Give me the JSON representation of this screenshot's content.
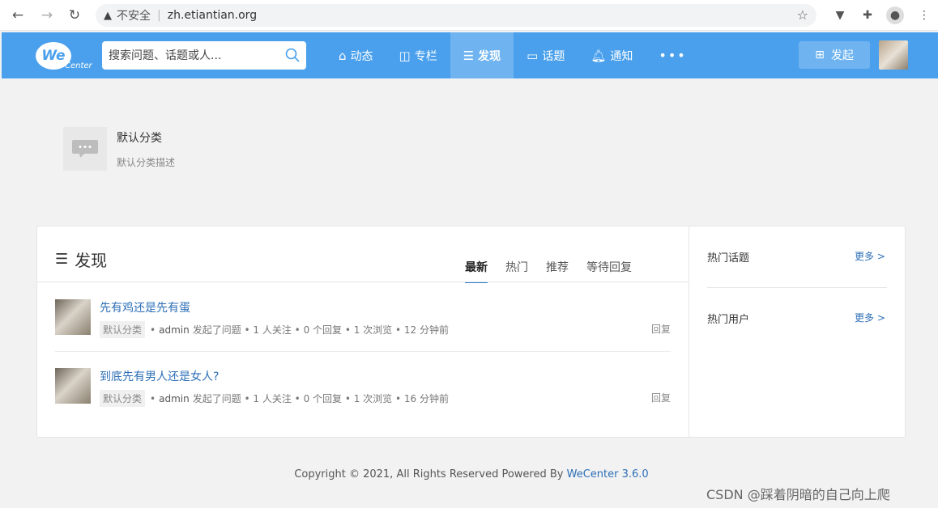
{
  "browser": {
    "security_label": "不安全",
    "url": "zh.etiantian.org"
  },
  "header": {
    "logo_main": "We",
    "logo_sub": "Center",
    "search_placeholder": "搜索问题、话题或人...",
    "nav": [
      {
        "label": "动态",
        "icon": "home-icon"
      },
      {
        "label": "专栏",
        "icon": "columns-icon"
      },
      {
        "label": "发现",
        "icon": "list-icon",
        "active": true
      },
      {
        "label": "话题",
        "icon": "topic-icon"
      },
      {
        "label": "通知",
        "icon": "bell-icon"
      },
      {
        "label": "•••",
        "icon": "more-icon"
      }
    ],
    "post_label": "发起"
  },
  "category": {
    "title": "默认分类",
    "description": "默认分类描述"
  },
  "discover": {
    "title": "发现",
    "tabs": [
      "最新",
      "热门",
      "推荐",
      "等待回复"
    ],
    "active_tab": "最新",
    "items": [
      {
        "question": "先有鸡还是先有蛋",
        "tag": "默认分类",
        "user": "admin",
        "meta": "发起了问题 • 1 人关注 • 0 个回复 • 1 次浏览 • 12 分钟前",
        "reply": "回复"
      },
      {
        "question": "到底先有男人还是女人?",
        "tag": "默认分类",
        "user": "admin",
        "meta": "发起了问题 • 1 人关注 • 0 个回复 • 1 次浏览 • 16 分钟前",
        "reply": "回复"
      }
    ]
  },
  "sidebar": {
    "hot_topics": "热门话题",
    "hot_users": "热门用户",
    "more": "更多 >"
  },
  "footer": {
    "copyright": "Copyright © 2021, All Rights Reserved Powered By ",
    "brand": "WeCenter 3.6.0"
  },
  "watermark": "CSDN @踩着阴暗的自己向上爬",
  "colors": {
    "header_bg": "#4aa0ec",
    "active_nav": "#6fb4f0",
    "link": "#2d6fb7"
  }
}
